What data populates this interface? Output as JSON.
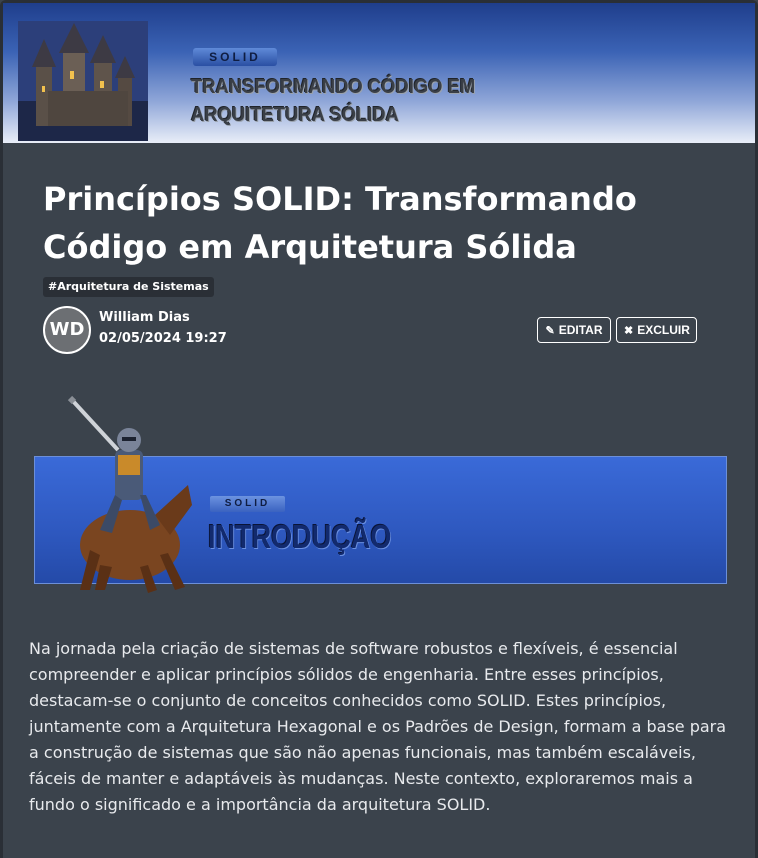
{
  "banner": {
    "tag": "SOLID",
    "title": "TRANSFORMANDO CÓDIGO EM ARQUITETURA SÓLIDA"
  },
  "article": {
    "title": "Princípios SOLID: Transformando Código em Arquitetura Sólida",
    "tag": "#Arquitetura de Sistemas",
    "author_initials": "WD",
    "author_name": "William Dias",
    "date": "02/05/2024 19:27",
    "edit_label": "EDITAR",
    "delete_label": "EXCLUIR"
  },
  "section_banner": {
    "tag": "SOLID",
    "title": "INTRODUÇÃO"
  },
  "body": {
    "paragraph": "Na jornada pela criação de sistemas de software robustos e flexíveis, é essencial compreender e aplicar princípios sólidos de engenharia. Entre esses princípios, destacam-se o conjunto de conceitos conhecidos como SOLID. Estes princípios, juntamente com a Arquitetura Hexagonal e os Padrões de Design, formam a base para a construção de sistemas que são não apenas funcionais, mas também escaláveis, fáceis de manter e adaptáveis às mudanças. Neste contexto, exploraremos mais a fundo o significado e a importância da arquitetura SOLID."
  },
  "icons": {
    "edit": "pencil-icon",
    "delete": "x-icon"
  },
  "colors": {
    "background": "#3b434c",
    "banner_blue": "#1f3e8c",
    "section_blue": "#2e58bf"
  }
}
